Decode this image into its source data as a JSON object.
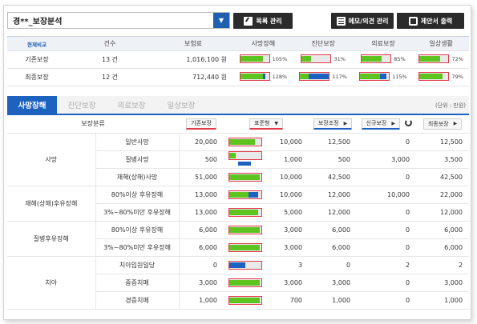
{
  "header": {
    "customer": "경**_보장분석",
    "dropdown_icon": "chevron-down",
    "buttons": [
      {
        "label": "목록 관리",
        "icon": "edit-icon"
      },
      {
        "label": "메모/의견 관리",
        "icon": "memo-icon"
      },
      {
        "label": "제안서 출력",
        "icon": "print-icon"
      }
    ]
  },
  "summary": {
    "headers": [
      "현재비교",
      "건수",
      "보험료",
      "사망장해",
      "진단보장",
      "의료보장",
      "일상생활"
    ],
    "rows": [
      {
        "label": "기존보장",
        "count": "13 건",
        "premium": "1,016,100 원",
        "bars": [
          {
            "pct": "105%",
            "fill": 0.78,
            "blue": 0
          },
          {
            "pct": "31%",
            "fill": 0.31,
            "blue": 0
          },
          {
            "pct": "85%",
            "fill": 0.68,
            "blue": 0
          },
          {
            "pct": "72%",
            "fill": 0.72,
            "blue": 0
          }
        ]
      },
      {
        "label": "최종보장",
        "count": "12 건",
        "premium": "712,440 원",
        "bars": [
          {
            "pct": "128%",
            "fill": 0.78,
            "blue": 0.1
          },
          {
            "pct": "117%",
            "fill": 0.3,
            "blue": 0.7
          },
          {
            "pct": "115%",
            "fill": 0.7,
            "blue": 0.2
          },
          {
            "pct": "79%",
            "fill": 0.79,
            "blue": 0
          }
        ]
      }
    ]
  },
  "tabs": [
    "사망장해",
    "진단보장",
    "의료보장",
    "일상보장"
  ],
  "unit": "(단위 : 만원)",
  "detail": {
    "headers": {
      "category": "보장분류",
      "base": "기존보장",
      "standard": "표준형",
      "adjust": "보장조정",
      "new": "신규보장",
      "final": "최종보장"
    },
    "rows": [
      {
        "cat": "사망",
        "sub": "일반사망",
        "base": "20,000",
        "v1": "10,000",
        "v2": "12,500",
        "v3": "0",
        "v4": "12,500",
        "fill": 0.8,
        "blue": 0,
        "tail": false
      },
      {
        "cat": "",
        "sub": "질병사망",
        "base": "500",
        "v1": "1,000",
        "v2": "500",
        "v3": "3,000",
        "v4": "3,500",
        "fill": 0.2,
        "blue": 0,
        "tail": true
      },
      {
        "cat": "",
        "sub": "재해(상해)사망",
        "base": "51,000",
        "v1": "10,000",
        "v2": "42,500",
        "v3": "0",
        "v4": "42,500",
        "fill": 0.95,
        "blue": 0,
        "tail": false
      },
      {
        "cat": "재해(상해)후유장해",
        "sub": "80%이상 후유장해",
        "base": "13,000",
        "v1": "10,000",
        "v2": "12,000",
        "v3": "10,000",
        "v4": "22,000",
        "fill": 0.6,
        "blue": 0.3,
        "tail": false
      },
      {
        "cat": "",
        "sub": "3%~80%미만 후유장해",
        "base": "13,000",
        "v1": "5,000",
        "v2": "12,000",
        "v3": "0",
        "v4": "12,000",
        "fill": 0.9,
        "blue": 0,
        "tail": false
      },
      {
        "cat": "질병후유장해",
        "sub": "80%이상 후유장해",
        "base": "6,000",
        "v1": "3,000",
        "v2": "6,000",
        "v3": "0",
        "v4": "6,000",
        "fill": 0.95,
        "blue": 0,
        "tail": false
      },
      {
        "cat": "",
        "sub": "3%~80%미만 후유장해",
        "base": "6,000",
        "v1": "3,000",
        "v2": "6,000",
        "v3": "0",
        "v4": "6,000",
        "fill": 0.95,
        "blue": 0,
        "tail": false
      },
      {
        "cat": "치아",
        "sub": "치아임원일당",
        "base": "0",
        "v1": "3",
        "v2": "0",
        "v3": "2",
        "v4": "2",
        "fill": 0,
        "blue": 0.5,
        "tail": false
      },
      {
        "cat": "",
        "sub": "중증치매",
        "base": "3,000",
        "v1": "3,000",
        "v2": "3,000",
        "v3": "0",
        "v4": "3,000",
        "fill": 0.95,
        "blue": 0,
        "tail": false
      },
      {
        "cat": "",
        "sub": "경증치매",
        "base": "1,000",
        "v1": "700",
        "v2": "1,000",
        "v3": "0",
        "v4": "1,000",
        "fill": 0.95,
        "blue": 0,
        "tail": false
      }
    ]
  },
  "colors": {
    "accent": "#1e62c0",
    "green": "#5cc31f",
    "red_border": "#e23b4a"
  }
}
